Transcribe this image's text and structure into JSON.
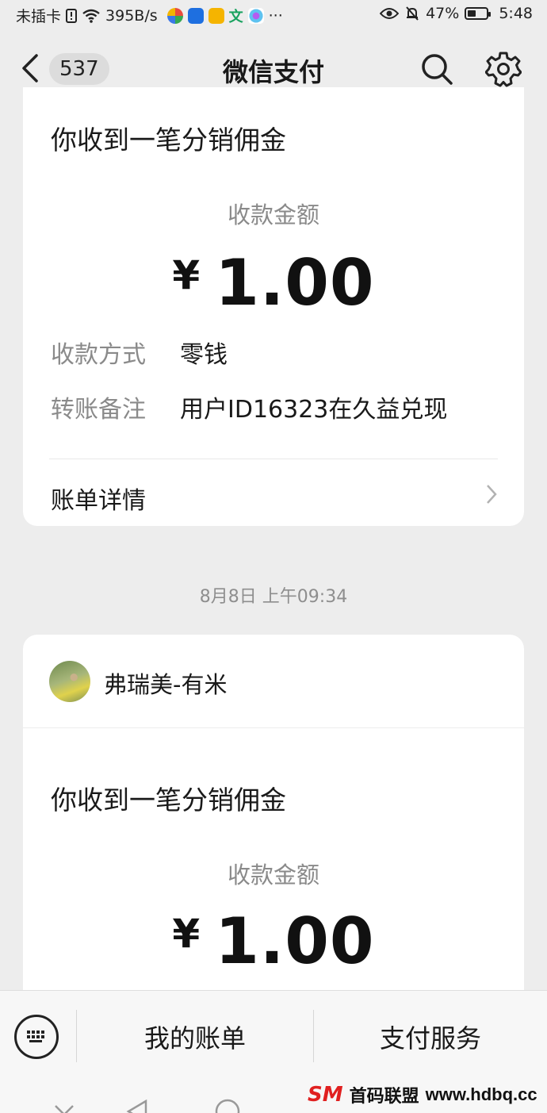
{
  "status_bar": {
    "carrier": "未插卡",
    "speed": "395B/s",
    "more": "···",
    "battery_pct": "47%",
    "battery_level": 0.47,
    "time": "5:48"
  },
  "nav": {
    "unread_count": "537",
    "title": "微信支付",
    "icons": [
      "back-icon",
      "search-icon",
      "gear-icon"
    ]
  },
  "messages": [
    {
      "title": "你收到一笔分销佣金",
      "amount_label": "收款金额",
      "currency": "¥",
      "amount": "1.00",
      "method_label": "收款方式",
      "method_value": "零钱",
      "note_label": "转账备注",
      "note_value": "用户ID16323在久益兑现",
      "detail_link": "账单详情"
    },
    {
      "timestamp": "8月8日 上午09:34",
      "sender": "弗瑞美-有米",
      "title": "你收到一笔分销佣金",
      "amount_label": "收款金额",
      "currency": "¥",
      "amount": "1.00"
    }
  ],
  "bottom_bar": {
    "my_bill": "我的账单",
    "pay_service": "支付服务"
  },
  "watermark": {
    "logo": "SM",
    "name": "首码联盟",
    "url": "www.hdbq.cc"
  },
  "colors": {
    "background": "#ededed",
    "card": "#ffffff",
    "muted_text": "#8a8a8a",
    "watermark_red": "#e02020"
  }
}
